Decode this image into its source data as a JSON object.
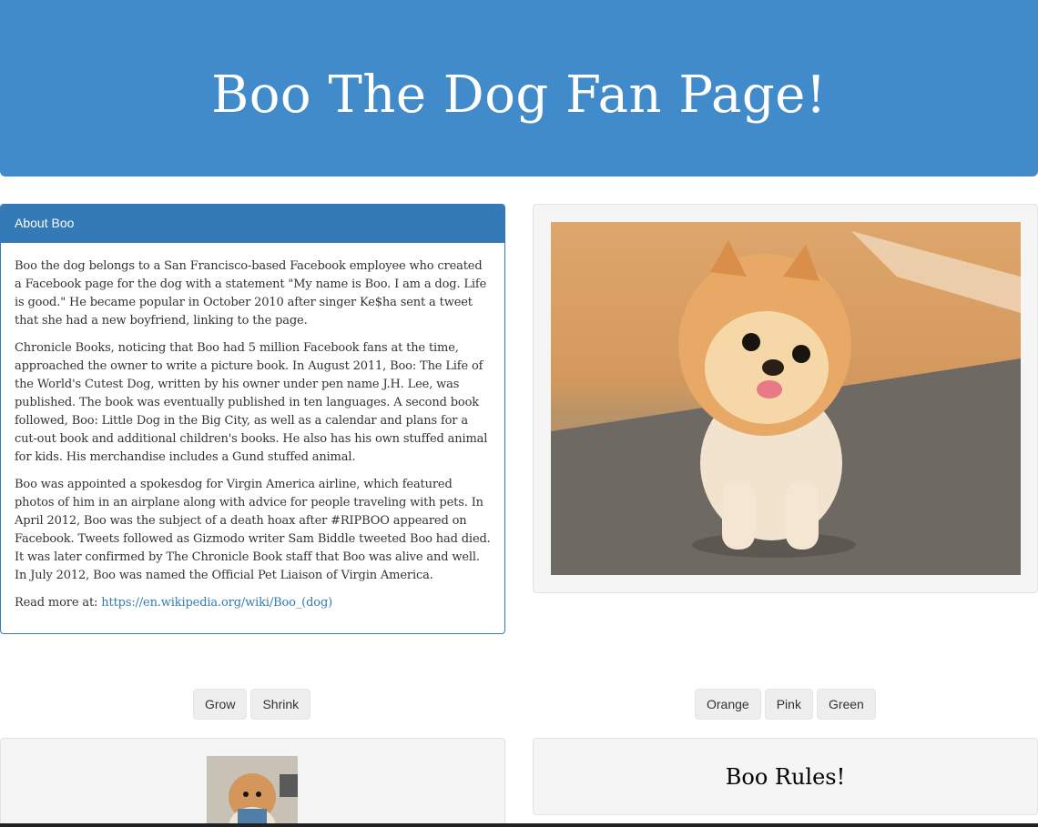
{
  "header": {
    "title": "Boo The Dog Fan Page!"
  },
  "about": {
    "heading": "About Boo",
    "paragraphs": [
      "Boo the dog belongs to a San Francisco-based Facebook employee who created a Facebook page for the dog with a statement \"My name is Boo. I am a dog. Life is good.\" He became popular in October 2010 after singer Ke$ha sent a tweet that she had a new boyfriend, linking to the page.",
      "Chronicle Books, noticing that Boo had 5 million Facebook fans at the time, approached the owner to write a picture book. In August 2011, Boo: The Life of the World's Cutest Dog, written by his owner under pen name J.H. Lee, was published. The book was eventually published in ten languages. A second book followed, Boo: Little Dog in the Big City, as well as a calendar and plans for a cut-out book and additional children's books. He also has his own stuffed animal for kids. His merchandise includes a Gund stuffed animal.",
      "Boo was appointed a spokesdog for Virgin America airline, which featured photos of him in an airplane along with advice for people traveling with pets. In April 2012, Boo was the subject of a death hoax after #RIPBOO appeared on Facebook. Tweets followed as Gizmodo writer Sam Biddle tweeted Boo had died. It was later confirmed by The Chronicle Book staff that Boo was alive and well. In July 2012, Boo was named the Official Pet Liaison of Virgin America."
    ],
    "read_more_label": "Read more at: ",
    "read_more_link": "https://en.wikipedia.org/wiki/Boo_(dog)"
  },
  "size_buttons": {
    "grow": "Grow",
    "shrink": "Shrink"
  },
  "color_buttons": {
    "orange": "Orange",
    "pink": "Pink",
    "green": "Green"
  },
  "banner": {
    "text": "Boo Rules!"
  },
  "colors": {
    "primary": "#428bca",
    "panel": "#337ab7",
    "well": "#f5f5f5",
    "button": "#eeeeee"
  }
}
